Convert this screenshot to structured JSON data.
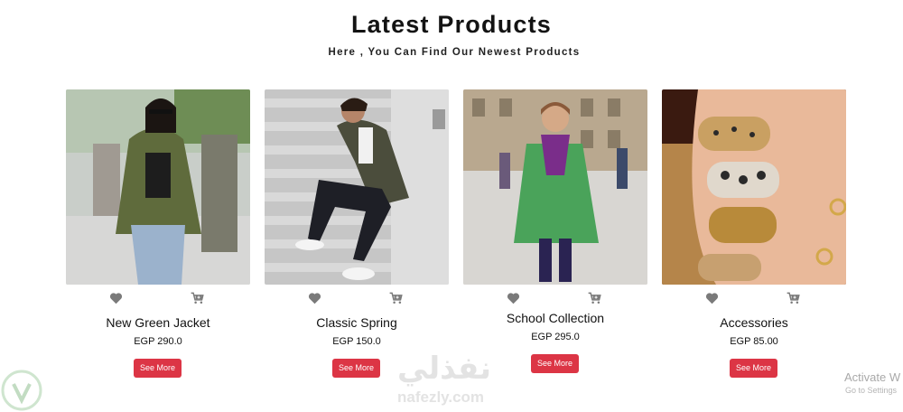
{
  "header": {
    "title": "Latest Products",
    "subtitle": "Here , You Can Find Our Newest Products"
  },
  "products": [
    {
      "name": "New Green Jacket",
      "price": "EGP 290.0",
      "button": "See More",
      "image": "woman-olive-jacket-street-photo"
    },
    {
      "name": "Classic Spring",
      "price": "EGP 150.0",
      "button": "See More",
      "image": "man-camo-jacket-stairs-photo"
    },
    {
      "name": "School Collection",
      "price": "EGP 295.0",
      "button": "See More",
      "image": "girl-green-coat-street-photo"
    },
    {
      "name": "Accessories",
      "price": "EGP 85.00",
      "button": "See More",
      "image": "gold-nails-jewelry-photo"
    }
  ],
  "icons": {
    "wishlist": "heart-icon",
    "cart": "add-to-cart-icon"
  },
  "colors": {
    "accent": "#dc3545",
    "icon_gray": "#7a7a7a",
    "title": "#131313"
  },
  "watermark": {
    "arabic": "نفذلي",
    "site": "nafezly.com"
  },
  "os_overlay": {
    "line1": "Activate W",
    "line2": "Go to Settings"
  }
}
